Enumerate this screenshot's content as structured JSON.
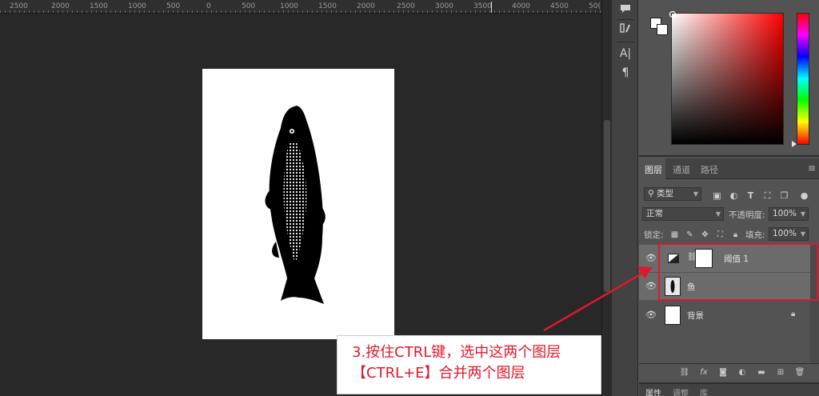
{
  "ruler": {
    "labels": [
      "2500",
      "2000",
      "1500",
      "1000",
      "500",
      "0",
      "500",
      "1000",
      "1500",
      "2000",
      "2500",
      "3000",
      "3500",
      "4000",
      "4500",
      "50("
    ]
  },
  "toolstrip": {
    "text_tool_glyph": "A|",
    "paragraph_glyph": "¶"
  },
  "layers": {
    "tabs": [
      "图层",
      "通道",
      "路径"
    ],
    "filter_kind": "类型",
    "blend_mode": "正常",
    "opacity_label": "不透明度:",
    "opacity_value": "100%",
    "lock_label": "锁定:",
    "fill_label": "填充:",
    "fill_value": "100%",
    "items": [
      {
        "name": "阈值 1",
        "selected": true,
        "type": "adjustment"
      },
      {
        "name": "鱼",
        "selected": true,
        "type": "pixel"
      },
      {
        "name": "背景",
        "selected": false,
        "type": "background",
        "locked": true
      }
    ]
  },
  "properties": {
    "tabs": [
      "属性",
      "调整",
      "库"
    ]
  },
  "annotation": {
    "line1": "3.按住CTRL键，选中这两个图层",
    "line2": "【CTRL+E】合并两个图层",
    "color": "#e0182b"
  },
  "colors": {
    "accent_red": "#e0182b",
    "panel_bg": "#535353",
    "canvas_bg": "#282828"
  }
}
